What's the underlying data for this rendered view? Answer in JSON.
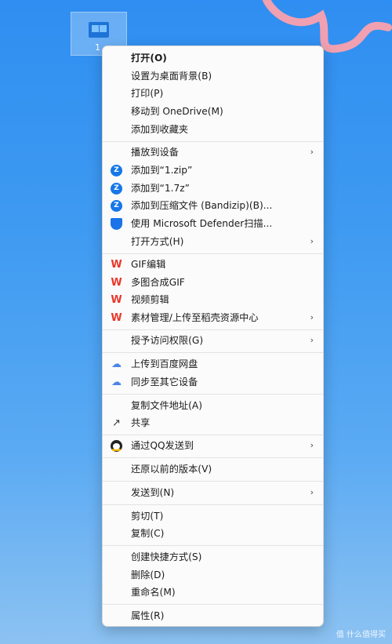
{
  "desktop": {
    "file_label": "1",
    "watermark": "值 什么值得买"
  },
  "menu": {
    "items": [
      {
        "label": "打开(O)",
        "bold": true
      },
      {
        "label": "设置为桌面背景(B)"
      },
      {
        "label": "打印(P)"
      },
      {
        "label": "移动到 OneDrive(M)"
      },
      {
        "label": "添加到收藏夹"
      },
      {
        "label": "播放到设备",
        "submenu": true
      },
      {
        "label": "添加到“1.zip”",
        "icon": "bandizip-icon"
      },
      {
        "label": "添加到“1.7z”",
        "icon": "bandizip-icon"
      },
      {
        "label": "添加到压缩文件 (Bandizip)(B)...",
        "icon": "bandizip-icon"
      },
      {
        "label": "使用 Microsoft Defender扫描...",
        "icon": "defender-shield-icon"
      },
      {
        "label": "打开方式(H)",
        "submenu": true
      },
      {
        "label": "GIF编辑",
        "icon": "wps-icon"
      },
      {
        "label": "多图合成GIF",
        "icon": "wps-icon"
      },
      {
        "label": "视频剪辑",
        "icon": "wps-icon"
      },
      {
        "label": "素材管理/上传至稻壳资源中心",
        "icon": "wps-icon",
        "submenu": true
      },
      {
        "label": "授予访问权限(G)",
        "submenu": true
      },
      {
        "label": "上传到百度网盘",
        "icon": "baidu-cloud-icon"
      },
      {
        "label": "同步至其它设备",
        "icon": "baidu-cloud-icon"
      },
      {
        "label": "复制文件地址(A)"
      },
      {
        "label": "共享",
        "icon": "share-icon"
      },
      {
        "label": "通过QQ发送到",
        "icon": "qq-icon",
        "submenu": true
      },
      {
        "label": "还原以前的版本(V)"
      },
      {
        "label": "发送到(N)",
        "submenu": true
      },
      {
        "label": "剪切(T)"
      },
      {
        "label": "复制(C)"
      },
      {
        "label": "创建快捷方式(S)"
      },
      {
        "label": "删除(D)"
      },
      {
        "label": "重命名(M)"
      },
      {
        "label": "属性(R)"
      }
    ],
    "submenu_glyph": "›",
    "colors": {
      "accent": "#1677e8",
      "wps_red": "#e8382a",
      "background": "#2f8ef1"
    }
  }
}
